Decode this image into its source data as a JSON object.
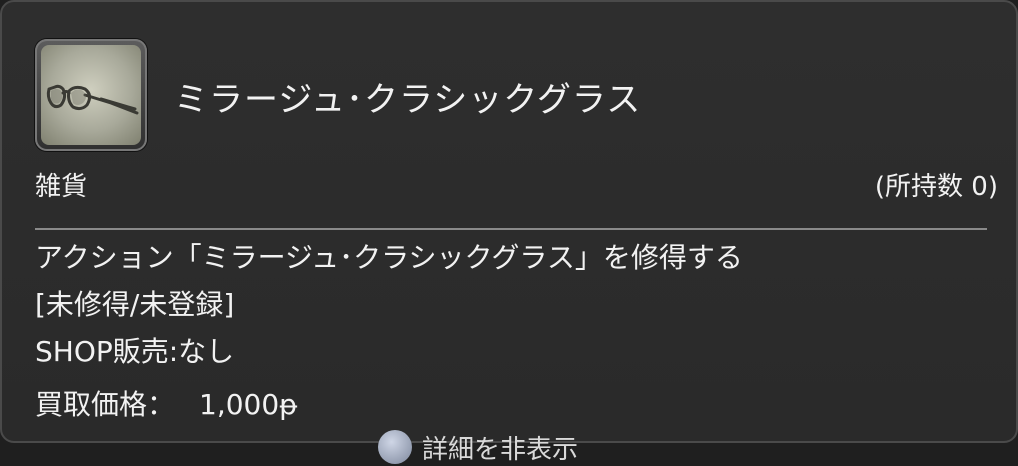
{
  "item": {
    "icon": "glasses-icon",
    "name": "ミラージュ･クラシックグラス",
    "category": "雑貨",
    "owned_count_text": "(所持数 0)"
  },
  "description": {
    "action_text": "アクション「ミラージュ･クラシックグラス」を修得する",
    "status_text": "[未修得/未登録]",
    "shop_text": "SHOP販売:なし",
    "price_label": "買取価格：",
    "price_value": "1,000ᵽ"
  },
  "footer": {
    "detail_button_label": "詳細を非表示"
  },
  "colors": {
    "panel_bg": "#2c2c2c",
    "text": "#f2f2f2",
    "divider": "#8a8a8a"
  }
}
